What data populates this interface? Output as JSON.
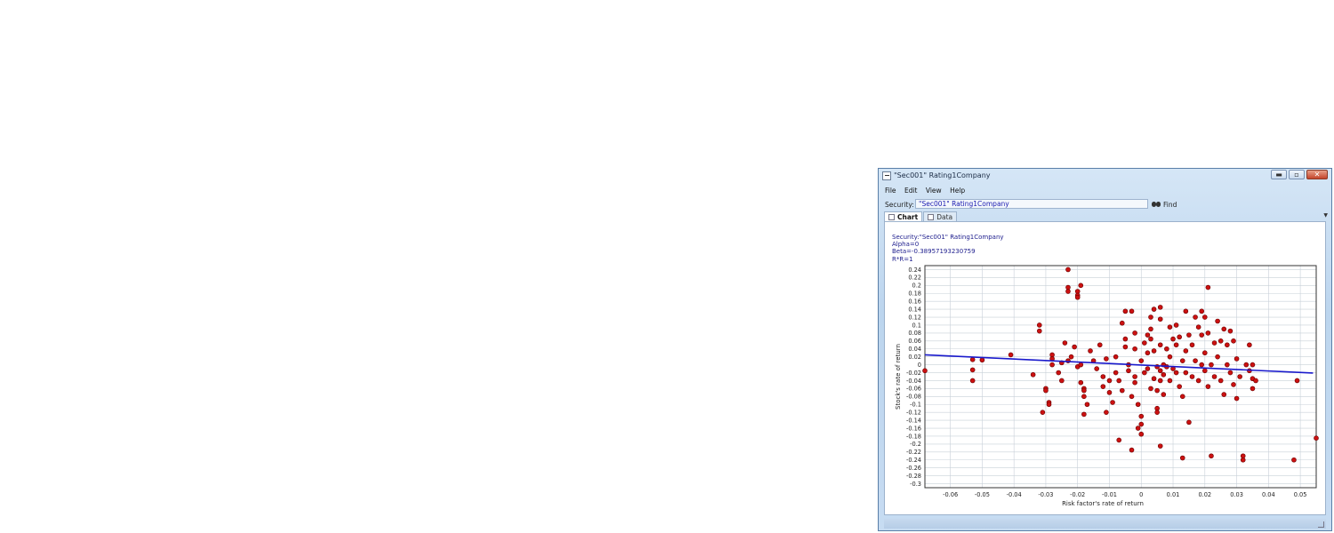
{
  "window": {
    "title": "\"Sec001\" Rating1Company",
    "controls": {
      "minimize": "▬",
      "maximize": "▫",
      "close": "✕"
    }
  },
  "menu": {
    "items": [
      "File",
      "Edit",
      "View",
      "Help"
    ]
  },
  "security": {
    "label": "Security:",
    "value": "\"Sec001\" Rating1Company",
    "find_label": "Find"
  },
  "tabs": [
    {
      "label": "Chart",
      "active": true
    },
    {
      "label": "Data",
      "active": false
    }
  ],
  "info": {
    "security": "Security:\"Sec001\" Rating1Company",
    "alpha": "Alpha=0",
    "beta": "Beta=-0.38957193230759",
    "rr": "R*R=1"
  },
  "colors": {
    "points": "#cc1111",
    "regression": "#1a1acc"
  },
  "chart_data": {
    "type": "scatter",
    "xlabel": "Risk factor's rate of return",
    "ylabel": "Stock's rate of return",
    "xlim": [
      -0.068,
      0.055
    ],
    "ylim": [
      -0.31,
      0.25
    ],
    "x_ticks": [
      -0.06,
      -0.05,
      -0.04,
      -0.03,
      -0.02,
      -0.01,
      0,
      0.01,
      0.02,
      0.03,
      0.04,
      0.05
    ],
    "y_ticks": [
      0.24,
      0.22,
      0.2,
      0.18,
      0.16,
      0.14,
      0.12,
      0.1,
      0.08,
      0.06,
      0.04,
      0.02,
      0,
      -0.02,
      -0.04,
      -0.06,
      -0.08,
      -0.1,
      -0.12,
      -0.14,
      -0.16,
      -0.18,
      -0.2,
      -0.22,
      -0.24,
      -0.26,
      -0.28,
      -0.3
    ],
    "grid": true,
    "regression_line": {
      "x": [
        -0.068,
        0.054
      ],
      "y": [
        0.025,
        -0.021
      ]
    },
    "points": [
      [
        -0.023,
        0.24
      ],
      [
        -0.023,
        0.195
      ],
      [
        -0.023,
        0.185
      ],
      [
        -0.019,
        0.2
      ],
      [
        -0.02,
        0.185
      ],
      [
        -0.02,
        0.175
      ],
      [
        -0.02,
        0.17
      ],
      [
        0.021,
        0.195
      ],
      [
        -0.068,
        -0.015
      ],
      [
        -0.053,
        0.013
      ],
      [
        -0.05,
        0.012
      ],
      [
        -0.053,
        -0.013
      ],
      [
        -0.053,
        -0.04
      ],
      [
        -0.041,
        0.025
      ],
      [
        -0.034,
        -0.025
      ],
      [
        -0.032,
        0.1
      ],
      [
        -0.032,
        0.085
      ],
      [
        -0.03,
        -0.06
      ],
      [
        -0.031,
        -0.12
      ],
      [
        -0.029,
        -0.095
      ],
      [
        -0.029,
        -0.1
      ],
      [
        -0.03,
        -0.065
      ],
      [
        -0.028,
        0.025
      ],
      [
        -0.028,
        0.015
      ],
      [
        -0.028,
        0.0
      ],
      [
        -0.026,
        -0.02
      ],
      [
        -0.025,
        0.005
      ],
      [
        -0.025,
        -0.04
      ],
      [
        -0.024,
        0.055
      ],
      [
        -0.023,
        0.01
      ],
      [
        -0.022,
        0.02
      ],
      [
        -0.021,
        0.045
      ],
      [
        -0.02,
        -0.005
      ],
      [
        -0.019,
        0.0
      ],
      [
        -0.019,
        -0.045
      ],
      [
        -0.018,
        -0.06
      ],
      [
        -0.018,
        -0.065
      ],
      [
        -0.018,
        -0.08
      ],
      [
        -0.017,
        -0.1
      ],
      [
        -0.018,
        -0.125
      ],
      [
        -0.016,
        0.035
      ],
      [
        -0.015,
        0.01
      ],
      [
        -0.014,
        -0.01
      ],
      [
        -0.013,
        0.05
      ],
      [
        -0.012,
        -0.03
      ],
      [
        -0.012,
        -0.055
      ],
      [
        -0.011,
        -0.12
      ],
      [
        -0.011,
        0.015
      ],
      [
        -0.01,
        -0.04
      ],
      [
        -0.01,
        -0.07
      ],
      [
        -0.009,
        -0.095
      ],
      [
        -0.008,
        0.02
      ],
      [
        -0.008,
        -0.02
      ],
      [
        -0.007,
        -0.04
      ],
      [
        -0.006,
        -0.065
      ],
      [
        -0.006,
        0.105
      ],
      [
        -0.005,
        0.065
      ],
      [
        -0.005,
        0.045
      ],
      [
        -0.005,
        0.135
      ],
      [
        -0.004,
        0.0
      ],
      [
        -0.004,
        -0.015
      ],
      [
        -0.003,
        0.135
      ],
      [
        -0.003,
        -0.08
      ],
      [
        -0.003,
        -0.215
      ],
      [
        -0.002,
        0.08
      ],
      [
        -0.002,
        0.04
      ],
      [
        -0.002,
        -0.03
      ],
      [
        -0.002,
        -0.045
      ],
      [
        -0.001,
        -0.1
      ],
      [
        -0.001,
        -0.16
      ],
      [
        -0.007,
        -0.19
      ],
      [
        0.0,
        -0.13
      ],
      [
        0.0,
        -0.15
      ],
      [
        0.0,
        -0.175
      ],
      [
        0.0,
        0.01
      ],
      [
        0.001,
        0.055
      ],
      [
        0.001,
        -0.02
      ],
      [
        0.002,
        0.075
      ],
      [
        0.002,
        -0.01
      ],
      [
        0.002,
        0.03
      ],
      [
        0.003,
        0.12
      ],
      [
        0.003,
        0.09
      ],
      [
        0.003,
        0.065
      ],
      [
        0.003,
        -0.06
      ],
      [
        0.004,
        0.14
      ],
      [
        0.004,
        0.035
      ],
      [
        0.004,
        -0.035
      ],
      [
        0.005,
        -0.005
      ],
      [
        0.005,
        -0.065
      ],
      [
        0.005,
        -0.11
      ],
      [
        0.005,
        -0.12
      ],
      [
        0.006,
        0.115
      ],
      [
        0.006,
        0.145
      ],
      [
        0.006,
        0.05
      ],
      [
        0.006,
        -0.015
      ],
      [
        0.006,
        -0.04
      ],
      [
        0.006,
        -0.205
      ],
      [
        0.007,
        0.0
      ],
      [
        0.007,
        -0.025
      ],
      [
        0.007,
        -0.075
      ],
      [
        0.008,
        0.04
      ],
      [
        0.008,
        -0.005
      ],
      [
        0.009,
        0.095
      ],
      [
        0.009,
        0.02
      ],
      [
        0.009,
        -0.04
      ],
      [
        0.01,
        0.065
      ],
      [
        0.01,
        -0.01
      ],
      [
        0.011,
        0.1
      ],
      [
        0.011,
        0.05
      ],
      [
        0.011,
        -0.02
      ],
      [
        0.012,
        0.07
      ],
      [
        0.012,
        -0.055
      ],
      [
        0.013,
        0.01
      ],
      [
        0.013,
        -0.08
      ],
      [
        0.013,
        -0.235
      ],
      [
        0.014,
        0.135
      ],
      [
        0.014,
        0.035
      ],
      [
        0.014,
        -0.02
      ],
      [
        0.015,
        -0.145
      ],
      [
        0.015,
        0.075
      ],
      [
        0.016,
        0.05
      ],
      [
        0.016,
        -0.03
      ],
      [
        0.017,
        0.12
      ],
      [
        0.017,
        0.01
      ],
      [
        0.018,
        0.095
      ],
      [
        0.018,
        -0.04
      ],
      [
        0.019,
        0.135
      ],
      [
        0.019,
        0.075
      ],
      [
        0.019,
        0.0
      ],
      [
        0.02,
        0.12
      ],
      [
        0.02,
        0.03
      ],
      [
        0.02,
        -0.015
      ],
      [
        0.021,
        0.08
      ],
      [
        0.021,
        -0.055
      ],
      [
        0.022,
        0.0
      ],
      [
        0.022,
        -0.23
      ],
      [
        0.023,
        0.055
      ],
      [
        0.023,
        -0.03
      ],
      [
        0.024,
        0.11
      ],
      [
        0.024,
        0.02
      ],
      [
        0.025,
        0.06
      ],
      [
        0.025,
        -0.04
      ],
      [
        0.026,
        0.09
      ],
      [
        0.026,
        -0.075
      ],
      [
        0.027,
        0.05
      ],
      [
        0.027,
        0.0
      ],
      [
        0.028,
        0.085
      ],
      [
        0.028,
        -0.02
      ],
      [
        0.029,
        0.06
      ],
      [
        0.029,
        -0.05
      ],
      [
        0.03,
        0.015
      ],
      [
        0.03,
        -0.085
      ],
      [
        0.031,
        -0.03
      ],
      [
        0.032,
        -0.23
      ],
      [
        0.032,
        -0.24
      ],
      [
        0.033,
        0.0
      ],
      [
        0.034,
        0.05
      ],
      [
        0.034,
        -0.015
      ],
      [
        0.035,
        -0.035
      ],
      [
        0.035,
        -0.06
      ],
      [
        0.035,
        0.0
      ],
      [
        0.036,
        -0.04
      ],
      [
        0.049,
        -0.04
      ],
      [
        0.048,
        -0.24
      ],
      [
        0.055,
        -0.185
      ]
    ]
  }
}
